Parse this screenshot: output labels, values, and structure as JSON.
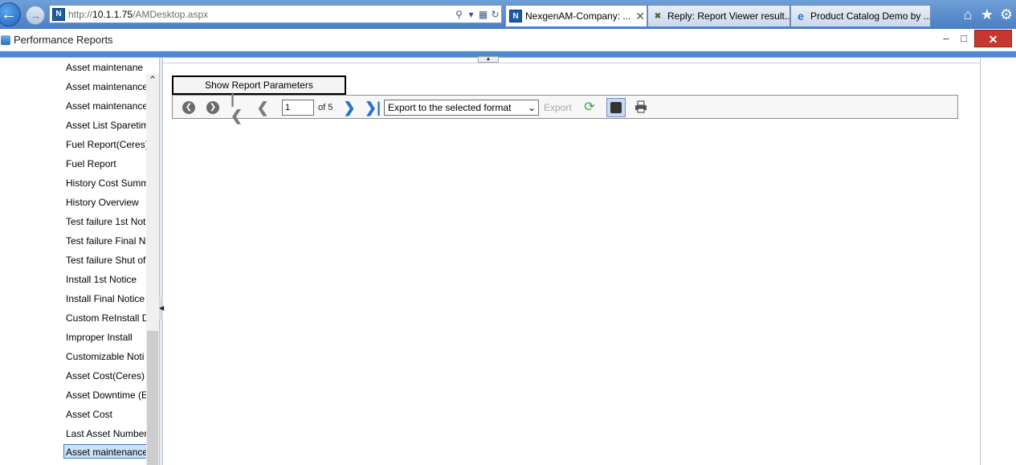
{
  "browser": {
    "url_prefix": "http://",
    "url_host": "10.1.1.75",
    "url_path": "/AMDesktop.aspx",
    "tabs": [
      {
        "label": "NexgenAM-Company: ...",
        "active": true
      },
      {
        "label": "Reply: Report Viewer result...",
        "active": false
      },
      {
        "label": "Product Catalog Demo by ...",
        "active": false
      }
    ],
    "icons": [
      "home-icon",
      "star-icon",
      "gear-icon"
    ]
  },
  "window": {
    "title": "Performance Reports",
    "min_glyph": "–",
    "max_glyph": "□",
    "close_glyph": "✕"
  },
  "sidebar": {
    "items": [
      "Asset maintenane (",
      "Asset maintenance",
      "Asset maintenance",
      "Asset List Sparetim",
      "Fuel Report(Ceres)",
      "Fuel Report",
      "History Cost Summ",
      "History Overview",
      "Test failure 1st Not",
      "Test failure Final N",
      "Test failure Shut of",
      "Install 1st Notice",
      "Install Final Notice",
      "Custom ReInstall D",
      "Improper Install",
      "Customizable Noti",
      "Asset Cost(Ceres)",
      "Asset Downtime (E",
      "Asset Cost",
      "Last Asset Number",
      "Asset maintenance"
    ],
    "selected_index": 20
  },
  "report": {
    "show_params_label": "Show Report Parameters",
    "page_current": "1",
    "page_of": "of 5",
    "export_select_value": "Export to the selected format",
    "export_label": "Export"
  }
}
